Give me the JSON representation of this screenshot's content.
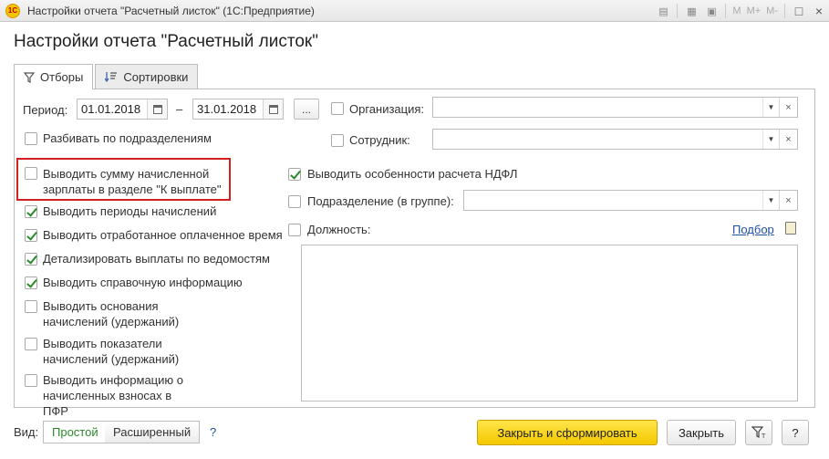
{
  "window": {
    "logo": "1С",
    "title": "Настройки отчета \"Расчетный листок\"  (1С:Предприятие)",
    "mem_m": "M",
    "mem_mplus": "M+",
    "mem_mminus": "M-",
    "maximize": "□",
    "close": "×"
  },
  "form_title": "Настройки отчета \"Расчетный листок\"",
  "tabs": [
    {
      "label": "Отборы",
      "icon": "filter-icon",
      "active": true
    },
    {
      "label": "Сортировки",
      "icon": "sort-icon",
      "active": false
    }
  ],
  "period": {
    "label": "Период:",
    "from": "01.01.2018",
    "dash": "–",
    "to": "31.01.2018",
    "dots": "..."
  },
  "organization": {
    "label": "Организация:",
    "value": ""
  },
  "employee": {
    "label": "Сотрудник:",
    "value": ""
  },
  "options_left": [
    {
      "text": "Разбивать по подразделениям",
      "checked": false
    },
    {
      "text": "Выводить сумму начисленной зарплаты в разделе \"К выплате\"",
      "checked": false,
      "highlighted": true
    },
    {
      "text": "Выводить периоды начислений",
      "checked": true
    },
    {
      "text": "Выводить отработанное оплаченное время",
      "checked": true
    },
    {
      "text": "Детализировать выплаты по ведомостям",
      "checked": true
    },
    {
      "text": "Выводить справочную информацию",
      "checked": true
    },
    {
      "text": "Выводить основания начислений (удержаний)",
      "checked": false
    },
    {
      "text": "Выводить показатели начислений (удержаний)",
      "checked": false
    },
    {
      "text": "Выводить информацию о начисленных взносах в ПФР",
      "checked": false
    }
  ],
  "ndfl": {
    "text": "Выводить особенности расчета НДФЛ",
    "checked": true
  },
  "department": {
    "text": "Подразделение (в группе):",
    "checked": false,
    "value": ""
  },
  "position": {
    "text": "Должность:",
    "checked": false
  },
  "pick_link": "Подбор",
  "bottom": {
    "view_label": "Вид:",
    "simple": "Простой",
    "extended": "Расширенный",
    "help": "?",
    "close_generate": "Закрыть и сформировать",
    "close": "Закрыть",
    "help_btn": "?"
  }
}
